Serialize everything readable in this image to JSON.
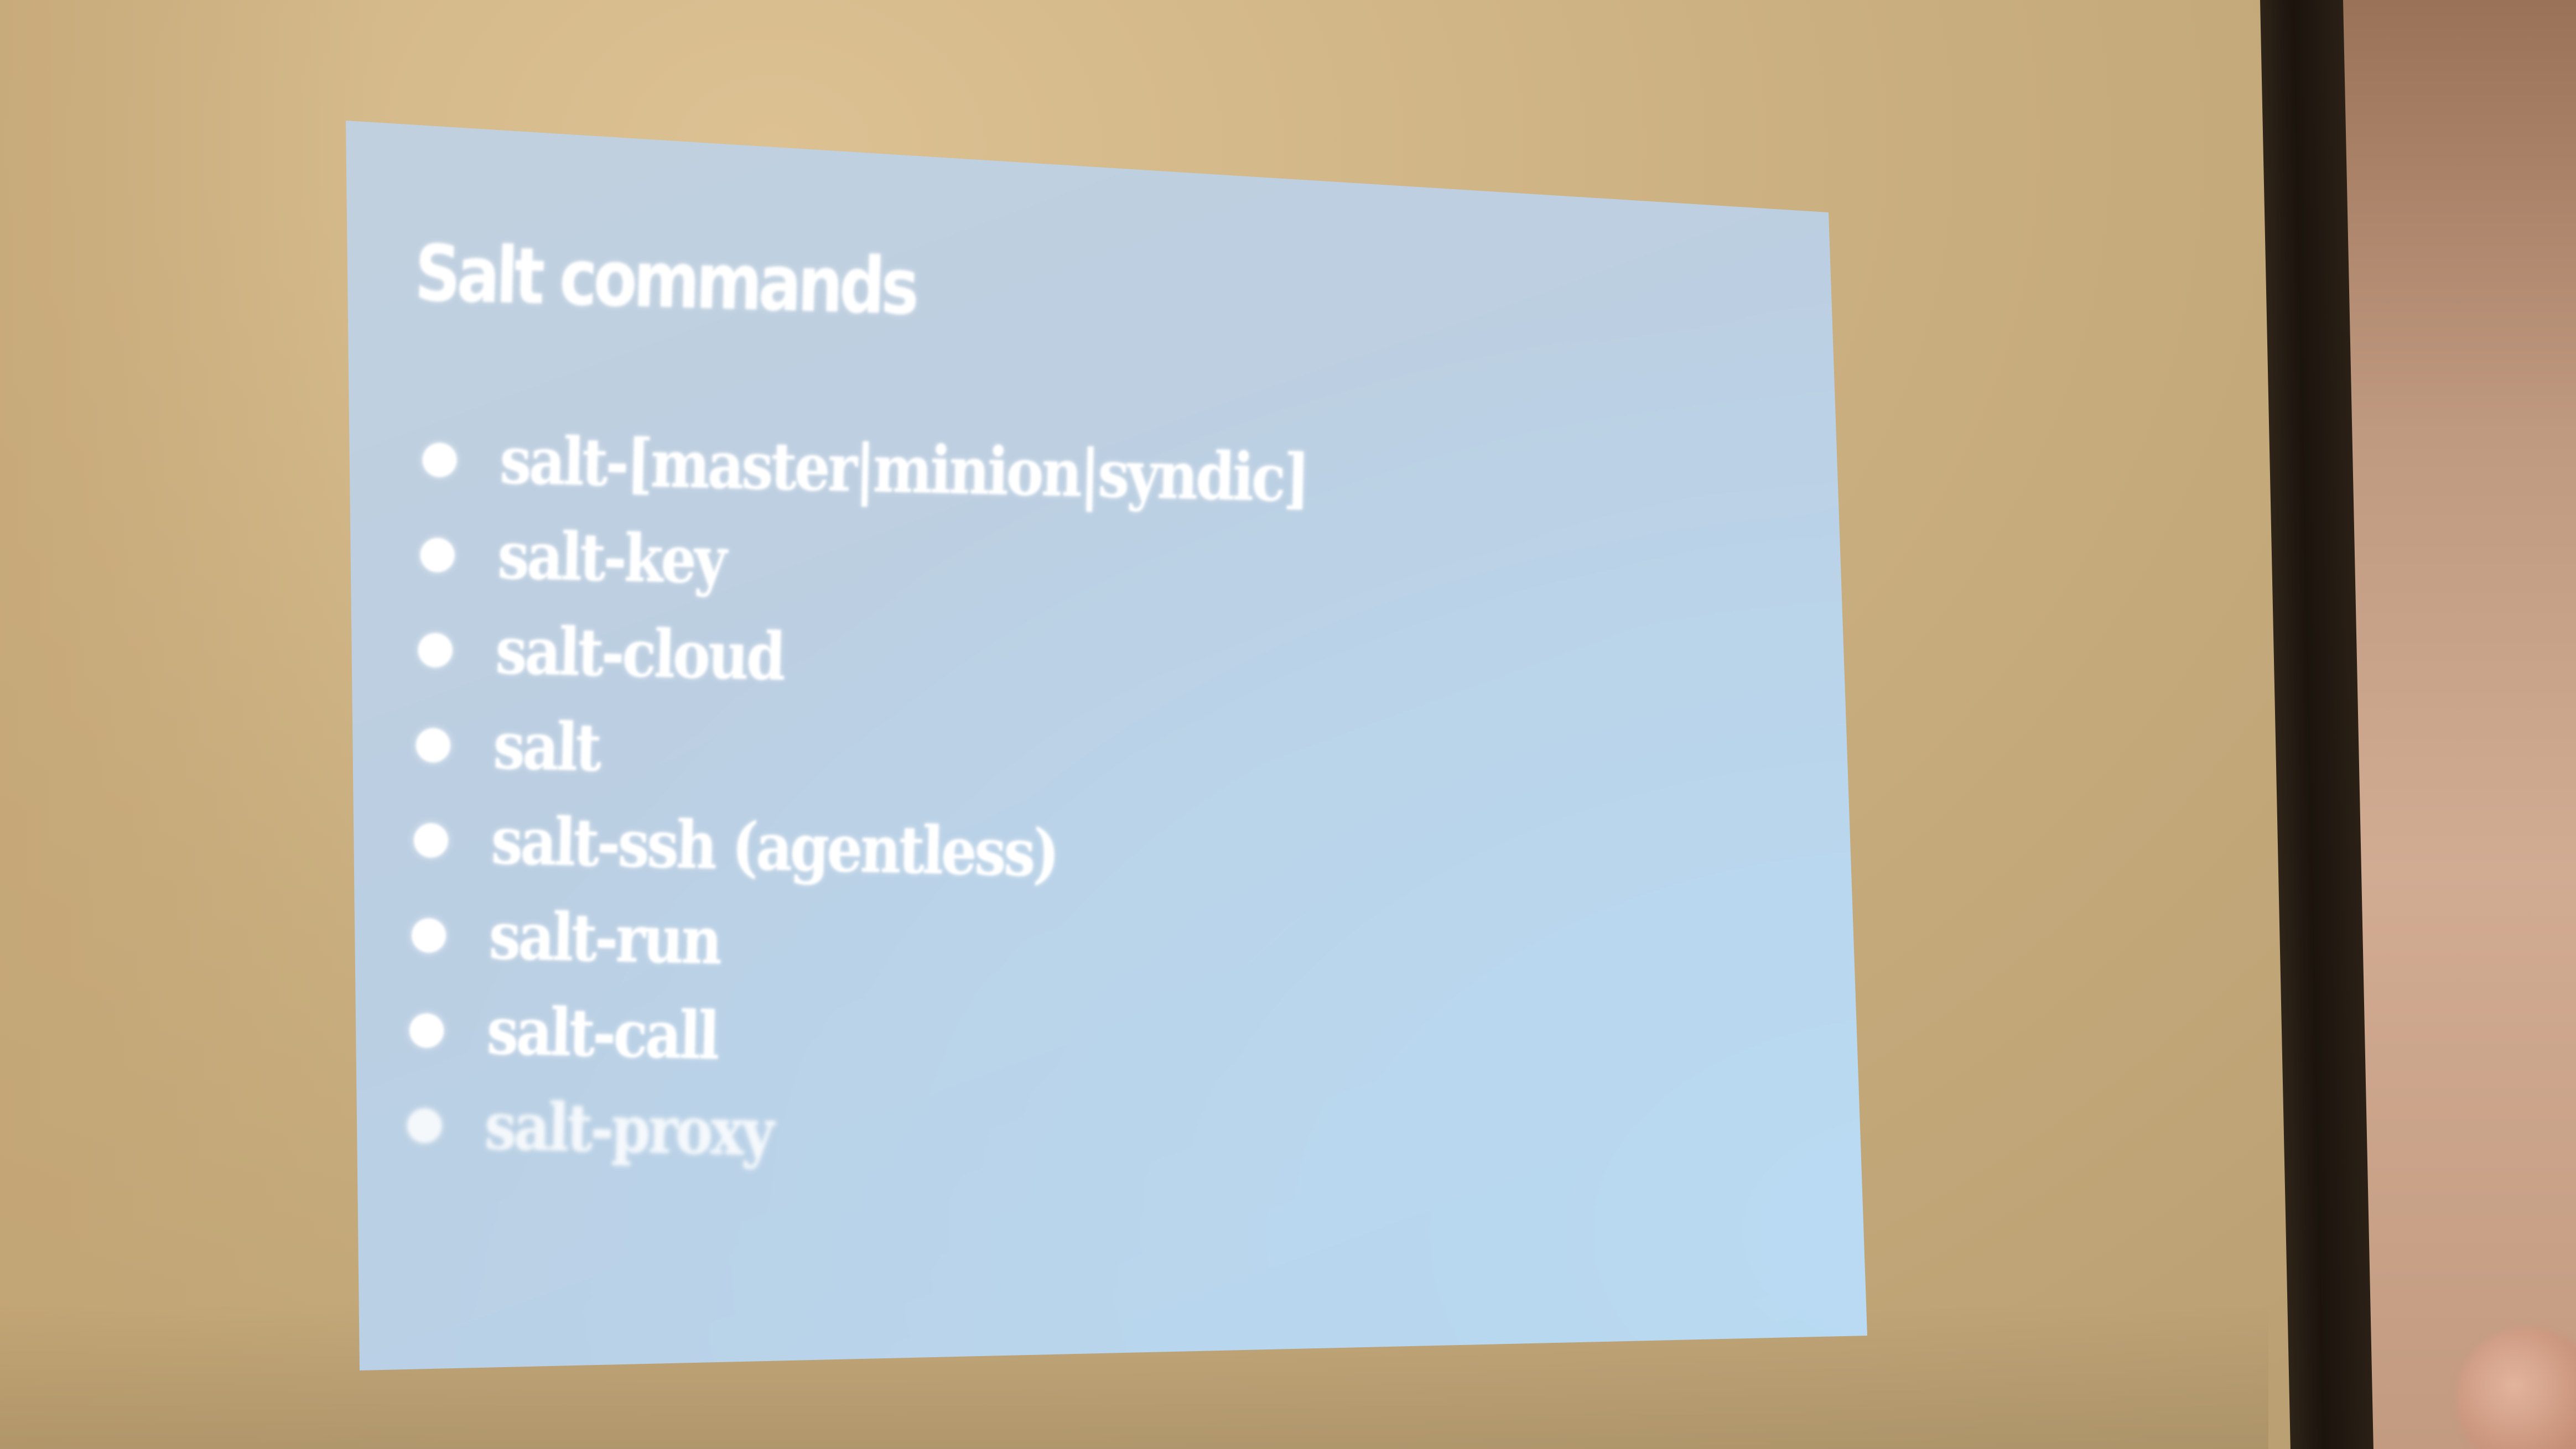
{
  "slide": {
    "title": "Salt commands",
    "items": [
      "salt-[master|minion|syndic]",
      "salt-key",
      "salt-cloud",
      "salt",
      "salt-ssh (agentless)",
      "salt-run",
      "salt-call",
      "salt-proxy"
    ]
  },
  "colors": {
    "wall": "#c9ad7e",
    "slide_background": "#bcd2e6",
    "slide_text": "#ffffff",
    "frame": "#1b140d"
  }
}
